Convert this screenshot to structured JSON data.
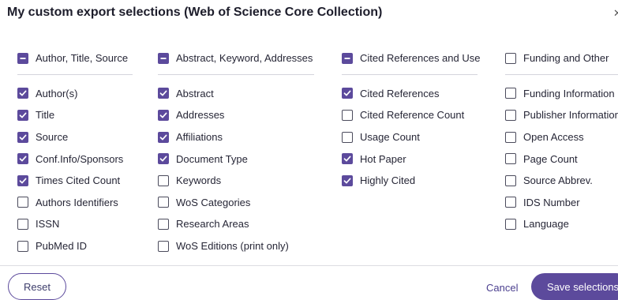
{
  "dialog": {
    "title": "My custom export selections (Web of Science Core Collection)",
    "close_icon": "close-icon"
  },
  "columns": [
    {
      "id": "author-title-source",
      "header": {
        "label": "Author, Title, Source",
        "state": "indeterminate"
      },
      "items": [
        {
          "label": "Author(s)",
          "checked": true
        },
        {
          "label": "Title",
          "checked": true
        },
        {
          "label": "Source",
          "checked": true
        },
        {
          "label": "Conf.Info/Sponsors",
          "checked": true
        },
        {
          "label": "Times Cited Count",
          "checked": true
        },
        {
          "label": "Authors Identifiers",
          "checked": false
        },
        {
          "label": "ISSN",
          "checked": false
        },
        {
          "label": "PubMed ID",
          "checked": false
        }
      ]
    },
    {
      "id": "abstract-keyword-addresses",
      "header": {
        "label": "Abstract, Keyword, Addresses",
        "state": "indeterminate"
      },
      "items": [
        {
          "label": "Abstract",
          "checked": true
        },
        {
          "label": "Addresses",
          "checked": true
        },
        {
          "label": "Affiliations",
          "checked": true
        },
        {
          "label": "Document Type",
          "checked": true
        },
        {
          "label": "Keywords",
          "checked": false
        },
        {
          "label": "WoS Categories",
          "checked": false
        },
        {
          "label": "Research Areas",
          "checked": false
        },
        {
          "label": "WoS Editions (print only)",
          "checked": false
        }
      ]
    },
    {
      "id": "cited-references-use",
      "header": {
        "label": "Cited References and Use",
        "state": "indeterminate"
      },
      "items": [
        {
          "label": "Cited References",
          "checked": true
        },
        {
          "label": "Cited Reference Count",
          "checked": false
        },
        {
          "label": "Usage Count",
          "checked": false
        },
        {
          "label": "Hot Paper",
          "checked": true
        },
        {
          "label": "Highly Cited",
          "checked": true
        }
      ]
    },
    {
      "id": "funding-other",
      "header": {
        "label": "Funding and Other",
        "state": "unchecked"
      },
      "items": [
        {
          "label": "Funding Information",
          "checked": false
        },
        {
          "label": "Publisher Information",
          "checked": false
        },
        {
          "label": "Open Access",
          "checked": false
        },
        {
          "label": "Page Count",
          "checked": false
        },
        {
          "label": "Source Abbrev.",
          "checked": false
        },
        {
          "label": "IDS Number",
          "checked": false
        },
        {
          "label": "Language",
          "checked": false
        }
      ]
    }
  ],
  "footer": {
    "reset_label": "Reset",
    "cancel_label": "Cancel",
    "save_label": "Save selections"
  },
  "colors": {
    "accent": "#5c4a9c",
    "checkbox_border": "#4b4b5c",
    "divider": "#dcdce2"
  }
}
